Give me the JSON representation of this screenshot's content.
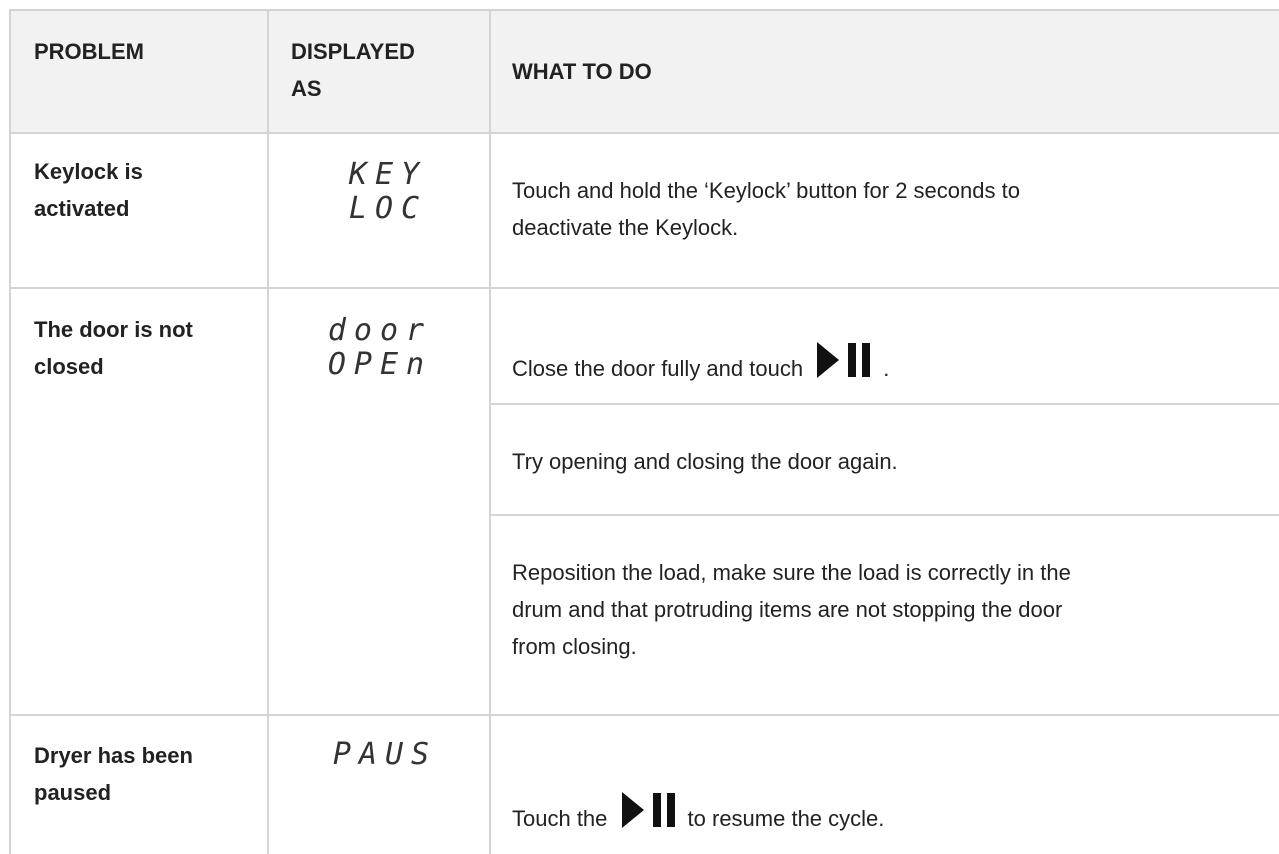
{
  "table": {
    "headers": {
      "problem": "PROBLEM",
      "displayed_as_line1": "DISPLAYED",
      "displayed_as_line2": "AS",
      "what_to_do": "WHAT TO DO"
    },
    "rows": [
      {
        "problem": [
          "Keylock is",
          "activated"
        ],
        "display": [
          "KEY",
          "LOC"
        ],
        "actions": [
          {
            "lines": [
              "Touch and hold the ‘Keylock’ button for 2 seconds to",
              "deactivate the Keylock."
            ]
          }
        ]
      },
      {
        "problem": [
          "The door is not",
          "closed"
        ],
        "display": [
          "door",
          "OPEn"
        ],
        "actions": [
          {
            "before_icon": "Close the door fully and touch",
            "after_icon": "."
          },
          {
            "lines": [
              "Try opening and closing the door again."
            ]
          },
          {
            "lines": [
              "Reposition the load, make sure the load is correctly in the",
              "drum and that protruding items are not stopping the door",
              "from closing."
            ]
          }
        ]
      },
      {
        "problem": [
          "Dryer has been",
          "paused"
        ],
        "display": [
          "PAUS"
        ],
        "actions": [
          {
            "before_icon": "Touch the",
            "after_icon": "to resume the cycle."
          }
        ]
      }
    ]
  },
  "icons": {
    "start_pause": "play-pause-icon"
  }
}
